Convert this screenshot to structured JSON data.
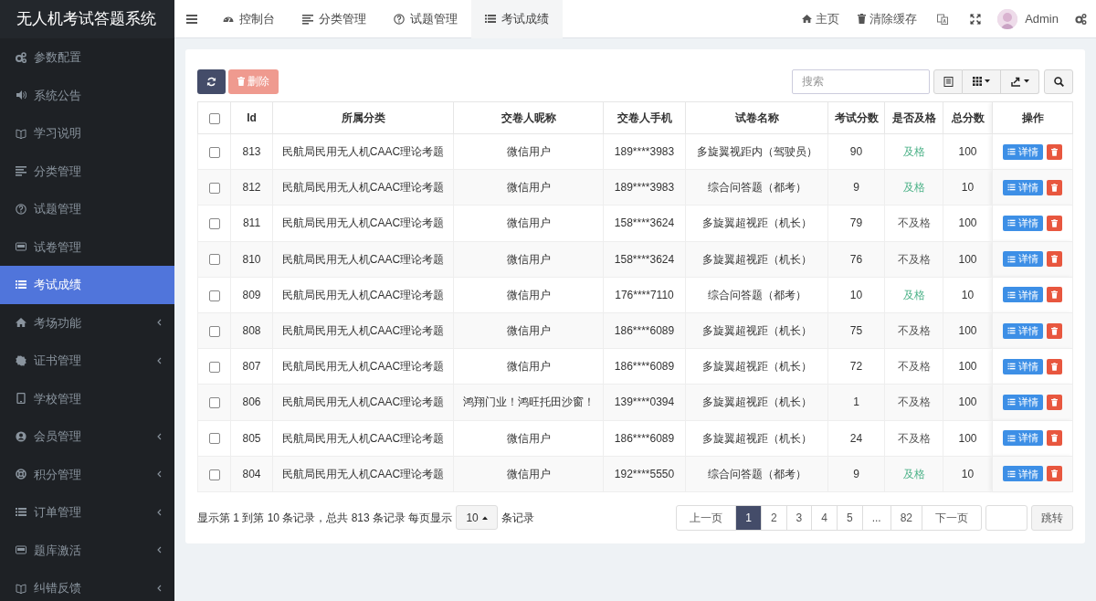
{
  "app_title": "无人机考试答题系统",
  "sidebar": {
    "items": [
      {
        "label": "参数配置",
        "selected": false,
        "expandable": false
      },
      {
        "label": "系统公告",
        "selected": false,
        "expandable": false
      },
      {
        "label": "学习说明",
        "selected": false,
        "expandable": false
      },
      {
        "label": "分类管理",
        "selected": false,
        "expandable": false
      },
      {
        "label": "试题管理",
        "selected": false,
        "expandable": false
      },
      {
        "label": "试卷管理",
        "selected": false,
        "expandable": false
      },
      {
        "label": "考试成绩",
        "selected": true,
        "expandable": false
      },
      {
        "label": "考场功能",
        "selected": false,
        "expandable": true
      },
      {
        "label": "证书管理",
        "selected": false,
        "expandable": true
      },
      {
        "label": "学校管理",
        "selected": false,
        "expandable": false
      },
      {
        "label": "会员管理",
        "selected": false,
        "expandable": true
      },
      {
        "label": "积分管理",
        "selected": false,
        "expandable": true
      },
      {
        "label": "订单管理",
        "selected": false,
        "expandable": true
      },
      {
        "label": "题库激活",
        "selected": false,
        "expandable": true
      },
      {
        "label": "纠错反馈",
        "selected": false,
        "expandable": true
      }
    ]
  },
  "nav_tabs": [
    {
      "label": "控制台",
      "selected": false
    },
    {
      "label": "分类管理",
      "selected": false
    },
    {
      "label": "试题管理",
      "selected": false
    },
    {
      "label": "考试成绩",
      "selected": true
    }
  ],
  "top_right": {
    "home": "主页",
    "clear_cache": "清除缓存",
    "user": "Admin"
  },
  "toolbar": {
    "delete": "删除",
    "search_placeholder": "搜索"
  },
  "table": {
    "select_all_checked": false,
    "columns": [
      "Id",
      "所属分类",
      "交卷人昵称",
      "交卷人手机",
      "试卷名称",
      "考试分数",
      "是否及格",
      "总分数",
      "操作"
    ],
    "rows": [
      {
        "id": "813",
        "category": "民航局民用无人机CAAC理论考题",
        "nickname": "微信用户",
        "phone": "189****3983",
        "paper": "多旋翼视距内（驾驶员）",
        "score": "90",
        "result": "及格",
        "passed": true,
        "total": "100",
        "checked": false,
        "action": "详情"
      },
      {
        "id": "812",
        "category": "民航局民用无人机CAAC理论考题",
        "nickname": "微信用户",
        "phone": "189****3983",
        "paper": "综合问答题（都考）",
        "score": "9",
        "result": "及格",
        "passed": true,
        "total": "10",
        "checked": false,
        "action": "详情"
      },
      {
        "id": "811",
        "category": "民航局民用无人机CAAC理论考题",
        "nickname": "微信用户",
        "phone": "158****3624",
        "paper": "多旋翼超视距（机长）",
        "score": "79",
        "result": "不及格",
        "passed": false,
        "total": "100",
        "checked": false,
        "action": "详情"
      },
      {
        "id": "810",
        "category": "民航局民用无人机CAAC理论考题",
        "nickname": "微信用户",
        "phone": "158****3624",
        "paper": "多旋翼超视距（机长）",
        "score": "76",
        "result": "不及格",
        "passed": false,
        "total": "100",
        "checked": false,
        "action": "详情"
      },
      {
        "id": "809",
        "category": "民航局民用无人机CAAC理论考题",
        "nickname": "微信用户",
        "phone": "176****7110",
        "paper": "综合问答题（都考）",
        "score": "10",
        "result": "及格",
        "passed": true,
        "total": "10",
        "checked": false,
        "action": "详情"
      },
      {
        "id": "808",
        "category": "民航局民用无人机CAAC理论考题",
        "nickname": "微信用户",
        "phone": "186****6089",
        "paper": "多旋翼超视距（机长）",
        "score": "75",
        "result": "不及格",
        "passed": false,
        "total": "100",
        "checked": false,
        "action": "详情"
      },
      {
        "id": "807",
        "category": "民航局民用无人机CAAC理论考题",
        "nickname": "微信用户",
        "phone": "186****6089",
        "paper": "多旋翼超视距（机长）",
        "score": "72",
        "result": "不及格",
        "passed": false,
        "total": "100",
        "checked": false,
        "action": "详情"
      },
      {
        "id": "806",
        "category": "民航局民用无人机CAAC理论考题",
        "nickname": "鸿翔门业！鸿旺托田沙窗！",
        "phone": "139****0394",
        "paper": "多旋翼超视距（机长）",
        "score": "1",
        "result": "不及格",
        "passed": false,
        "total": "100",
        "checked": false,
        "action": "详情"
      },
      {
        "id": "805",
        "category": "民航局民用无人机CAAC理论考题",
        "nickname": "微信用户",
        "phone": "186****6089",
        "paper": "多旋翼超视距（机长）",
        "score": "24",
        "result": "不及格",
        "passed": false,
        "total": "100",
        "checked": false,
        "action": "详情"
      },
      {
        "id": "804",
        "category": "民航局民用无人机CAAC理论考题",
        "nickname": "微信用户",
        "phone": "192****5550",
        "paper": "综合问答题（都考）",
        "score": "9",
        "result": "及格",
        "passed": true,
        "total": "10",
        "checked": false,
        "action": "详情"
      }
    ]
  },
  "pagination": {
    "summary_before": "显示第 1 到第 10 条记录，总共 813 条记录 每页显示",
    "page_size": "10",
    "summary_after": "条记录",
    "pages": [
      {
        "label": "上一页",
        "selected": false
      },
      {
        "label": "1",
        "selected": true
      },
      {
        "label": "2",
        "selected": false
      },
      {
        "label": "3",
        "selected": false
      },
      {
        "label": "4",
        "selected": false
      },
      {
        "label": "5",
        "selected": false
      },
      {
        "label": "...",
        "selected": false
      },
      {
        "label": "82",
        "selected": false
      },
      {
        "label": "下一页",
        "selected": false
      }
    ],
    "jump": "跳转"
  }
}
